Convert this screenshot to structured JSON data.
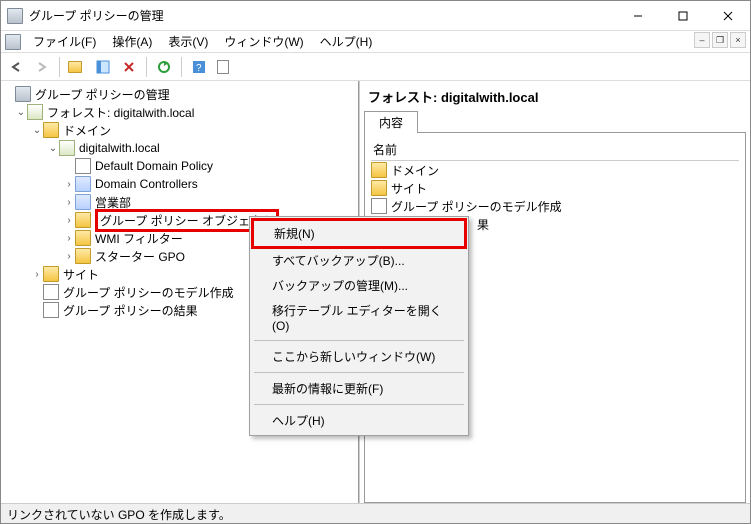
{
  "window": {
    "title": "グループ ポリシーの管理"
  },
  "menubar": {
    "file": "ファイル(F)",
    "action": "操作(A)",
    "view": "表示(V)",
    "window": "ウィンドウ(W)",
    "help": "ヘルプ(H)"
  },
  "tree": {
    "root": "グループ ポリシーの管理",
    "forest": "フォレスト: digitalwith.local",
    "domains": "ドメイン",
    "domain": "digitalwith.local",
    "default_policy": "Default Domain Policy",
    "domain_controllers": "Domain Controllers",
    "ou_sales": "営業部",
    "gpo_container": "グループ ポリシー オブジェクト",
    "wmi_filters": "WMI フィルター",
    "starter_gpo": "スターター GPO",
    "sites": "サイト",
    "modeling": "グループ ポリシーのモデル作成",
    "results": "グループ ポリシーの結果"
  },
  "detail": {
    "heading": "フォレスト: digitalwith.local",
    "tab": "内容",
    "col_name": "名前",
    "items": {
      "domains": "ドメイン",
      "sites": "サイト",
      "modeling": "グループ ポリシーのモデル作成",
      "results_partial": "果"
    }
  },
  "context_menu": {
    "new": "新規(N)",
    "backup_all": "すべてバックアップ(B)...",
    "manage_backup": "バックアップの管理(M)...",
    "migration_table": "移行テーブル エディターを開く(O)",
    "new_window": "ここから新しいウィンドウ(W)",
    "refresh": "最新の情報に更新(F)",
    "help": "ヘルプ(H)"
  },
  "statusbar": {
    "text": "リンクされていない GPO を作成します。"
  }
}
